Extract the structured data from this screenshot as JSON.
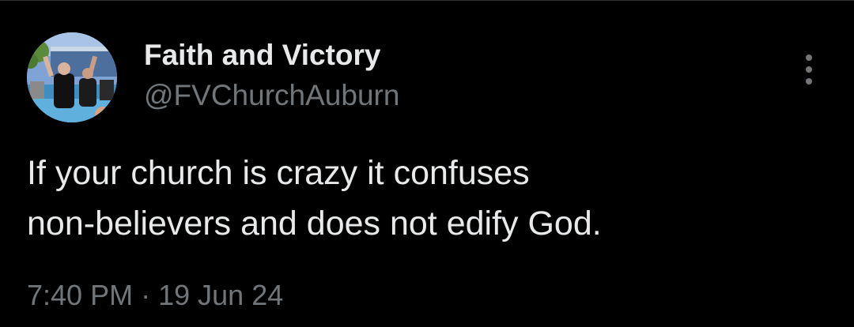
{
  "author": {
    "name": "Faith and Victory",
    "handle": "@FVChurchAuburn"
  },
  "menu": {
    "icon": "more-vertical-icon"
  },
  "tweet": {
    "lines": [
      "If your church is crazy it confuses",
      "non-believers and does not edify God."
    ]
  },
  "meta": {
    "time": "7:40 PM",
    "separator": "·",
    "date": "19 Jun 24"
  },
  "colors": {
    "background": "#000000",
    "primary_text": "#e7e9ea",
    "secondary_text": "#71767b"
  }
}
